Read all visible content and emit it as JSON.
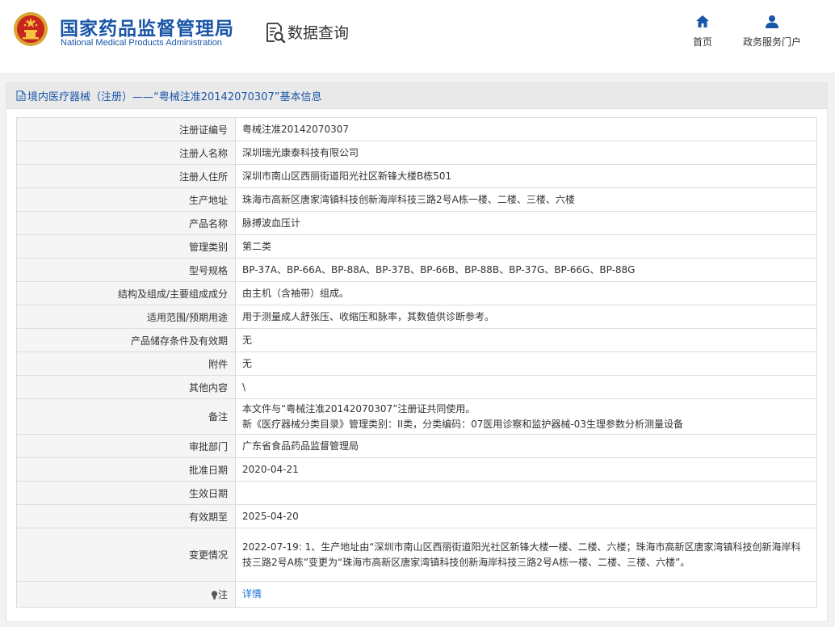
{
  "header": {
    "logo_cn": "国家药品监督管理局",
    "logo_en": "National Medical Products Administration",
    "data_query": "数据查询",
    "nav": {
      "home": "首页",
      "portal": "政务服务门户"
    }
  },
  "panel": {
    "title": "境内医疗器械（注册）——“粤械注准20142070307”基本信息"
  },
  "rows": [
    {
      "label": "注册证编号",
      "value": "粤械注准20142070307"
    },
    {
      "label": "注册人名称",
      "value": "深圳瑞光康泰科技有限公司"
    },
    {
      "label": "注册人住所",
      "value": "深圳市南山区西丽街道阳光社区新锋大楼B栋501"
    },
    {
      "label": "生产地址",
      "value": "珠海市高新区唐家湾镇科技创新海岸科技三路2号A栋一楼、二楼、三楼、六楼"
    },
    {
      "label": "产品名称",
      "value": "脉搏波血压计"
    },
    {
      "label": "管理类别",
      "value": "第二类"
    },
    {
      "label": "型号规格",
      "value": "BP-37A、BP-66A、BP-88A、BP-37B、BP-66B、BP-88B、BP-37G、BP-66G、BP-88G"
    },
    {
      "label": "结构及组成/主要组成成分",
      "value": "由主机（含袖带）组成。"
    },
    {
      "label": "适用范围/预期用途",
      "value": "用于测量成人舒张压、收缩压和脉率，其数值供诊断参考。"
    },
    {
      "label": "产品储存条件及有效期",
      "value": "无"
    },
    {
      "label": "附件",
      "value": "无"
    },
    {
      "label": "其他内容",
      "value": "\\"
    },
    {
      "label": "备注",
      "value_line1": "本文件与“粤械注准20142070307”注册证共同使用。",
      "value_line2": "新《医疗器械分类目录》管理类别：II类，分类编码：07医用诊察和监护器械-03生理参数分析测量设备"
    },
    {
      "label": "审批部门",
      "value": "广东省食品药品监督管理局"
    },
    {
      "label": "批准日期",
      "value": "2020-04-21"
    },
    {
      "label": "生效日期",
      "value": ""
    },
    {
      "label": "有效期至",
      "value": "2025-04-20"
    },
    {
      "label": "变更情况",
      "value": "2022-07-19: 1、生产地址由“深圳市南山区西丽街道阳光社区新锋大楼一楼、二楼、六楼；珠海市高新区唐家湾镇科技创新海岸科技三路2号A栋”变更为“珠海市高新区唐家湾镇科技创新海岸科技三路2号A栋一楼、二楼、三楼、六楼”。"
    },
    {
      "label": "注",
      "value": "详情"
    }
  ],
  "colors": {
    "brand_blue": "#1a56a8",
    "link_blue": "#1a6fd0",
    "label_bg": "#f5f5f5",
    "band_bg": "#f2f2f2"
  }
}
